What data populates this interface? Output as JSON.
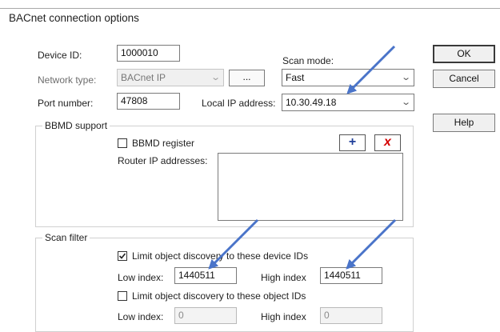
{
  "dialog": {
    "title": "BACnet connection options"
  },
  "fields": {
    "device_id": {
      "label": "Device ID:",
      "value": "1000010"
    },
    "network_type": {
      "label": "Network type:",
      "value": "BACnet IP",
      "browse_label": "..."
    },
    "port_number": {
      "label": "Port number:",
      "value": "47808"
    },
    "scan_mode": {
      "label": "Scan mode:",
      "value": "Fast"
    },
    "local_ip": {
      "label": "Local IP address:",
      "value": "10.30.49.18"
    }
  },
  "buttons": {
    "ok": "OK",
    "cancel": "Cancel",
    "help": "Help"
  },
  "bbmd": {
    "legend": "BBMD support",
    "register_label": "BBMD register",
    "register_checked": false,
    "router_label": "Router IP addresses:",
    "router_addresses": [],
    "add_glyph": "+",
    "remove_glyph": "x"
  },
  "scan_filter": {
    "legend": "Scan filter",
    "device_limit": {
      "label": "Limit object discovery to these device IDs",
      "checked": true,
      "low_label": "Low index:",
      "low_value": "1440511",
      "high_label": "High index",
      "high_value": "1440511"
    },
    "object_limit": {
      "label": "Limit object discovery to these object IDs",
      "checked": false,
      "low_label": "Low index:",
      "low_value": "0",
      "high_label": "High index",
      "high_value": "0"
    }
  },
  "colors": {
    "annotation_arrow": "#4a74c9",
    "remove_icon": "#d40000",
    "add_icon": "#1f3f9a"
  },
  "icons": {
    "add": "plus-icon",
    "remove": "red-x-icon",
    "dropdown": "chevron-down-icon",
    "check": "checkmark-icon"
  }
}
